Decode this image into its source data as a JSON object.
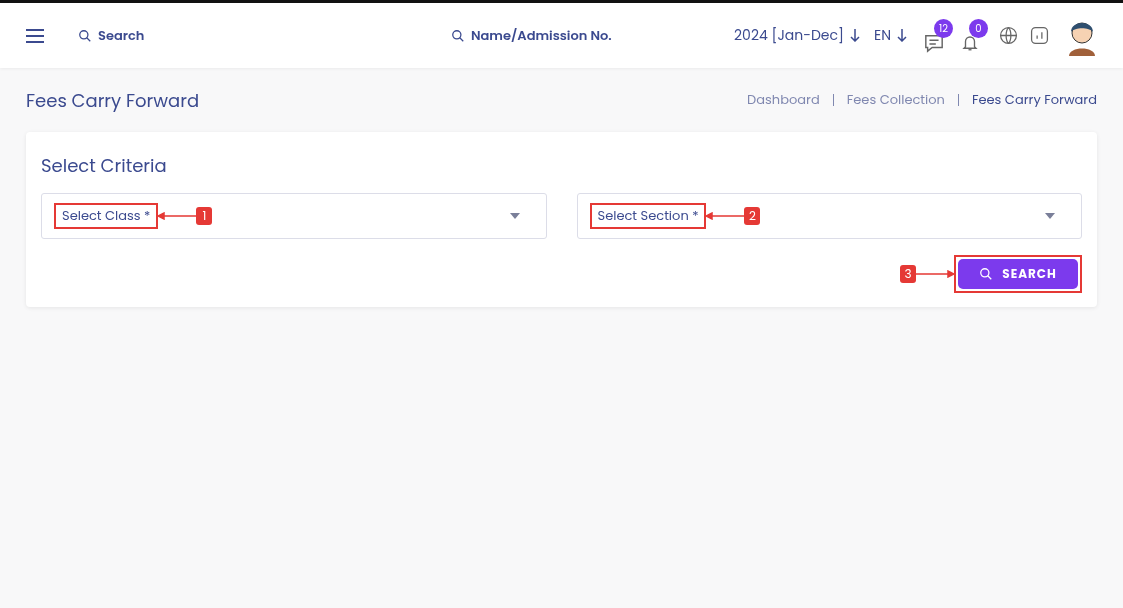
{
  "header": {
    "search": {
      "placeholder": "Search"
    },
    "student_search": {
      "placeholder": "Name/Admission No."
    },
    "session": "2024 [Jan-Dec]",
    "language": "EN",
    "messages_badge": "12",
    "notifications_badge": "0"
  },
  "page": {
    "title": "Fees Carry Forward",
    "breadcrumb": [
      {
        "label": "Dashboard",
        "selected": false
      },
      {
        "label": "Fees Collection",
        "selected": false
      },
      {
        "label": "Fees Carry Forward",
        "selected": true
      }
    ]
  },
  "card": {
    "title": "Select Criteria",
    "selects": [
      {
        "placeholder": "Select Class *",
        "marker": "1"
      },
      {
        "placeholder": "Select Section *",
        "marker": "2"
      }
    ],
    "search_button": {
      "label": "SEARCH",
      "marker": "3"
    }
  }
}
